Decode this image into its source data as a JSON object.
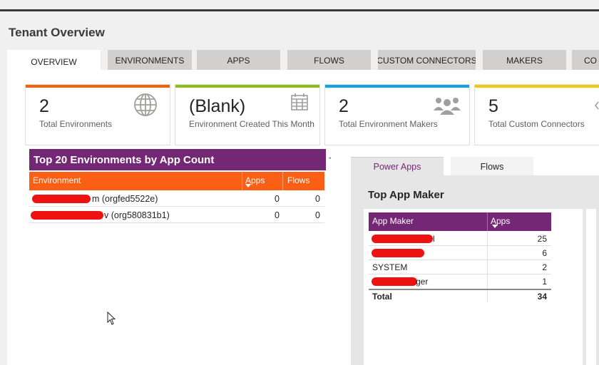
{
  "page_title": "Tenant Overview",
  "tabs": [
    {
      "label": "OVERVIEW",
      "active": true
    },
    {
      "label": "ENVIRONMENTS"
    },
    {
      "label": "APPS"
    },
    {
      "label": "FLOWS"
    },
    {
      "label": "CUSTOM CONNECTORS"
    },
    {
      "label": "MAKERS"
    },
    {
      "label": "CO"
    }
  ],
  "kpis": [
    {
      "value": "2",
      "label": "Total Environments",
      "color": "#f2610c",
      "icon": "globe-icon"
    },
    {
      "value": "(Blank)",
      "label": "Environment Created This Month",
      "color": "#8cbd18",
      "icon": "calendar-icon"
    },
    {
      "value": "2",
      "label": "Total Environment Makers",
      "color": "#0fa3e0",
      "icon": "people-icon"
    },
    {
      "value": "5",
      "label": "Total Custom Connectors",
      "color": "#f2c811",
      "icon": "connector-icon"
    }
  ],
  "env_table": {
    "title": "Top 20 Environments by App Count",
    "columns": [
      "Environment",
      "Apps",
      "Flows"
    ],
    "rows": [
      {
        "environment": "m (orgfed5522e)",
        "apps": "0",
        "flows": "0"
      },
      {
        "environment": "v (org580831b1)",
        "apps": "0",
        "flows": "0"
      }
    ]
  },
  "right_panel": {
    "tabs": [
      "Power Apps",
      "Flows"
    ],
    "title": "Top App Maker",
    "columns": [
      "App Maker",
      "Apps"
    ],
    "rows": [
      {
        "maker": "l",
        "apps": "25"
      },
      {
        "maker": "",
        "apps": "6"
      },
      {
        "maker": "SYSTEM",
        "apps": "2"
      },
      {
        "maker": "ger",
        "apps": "1"
      }
    ],
    "total_label": "Total",
    "total_value": "34"
  },
  "colors": {
    "header_purple": "#742774",
    "header_orange": "#fa5f15"
  }
}
